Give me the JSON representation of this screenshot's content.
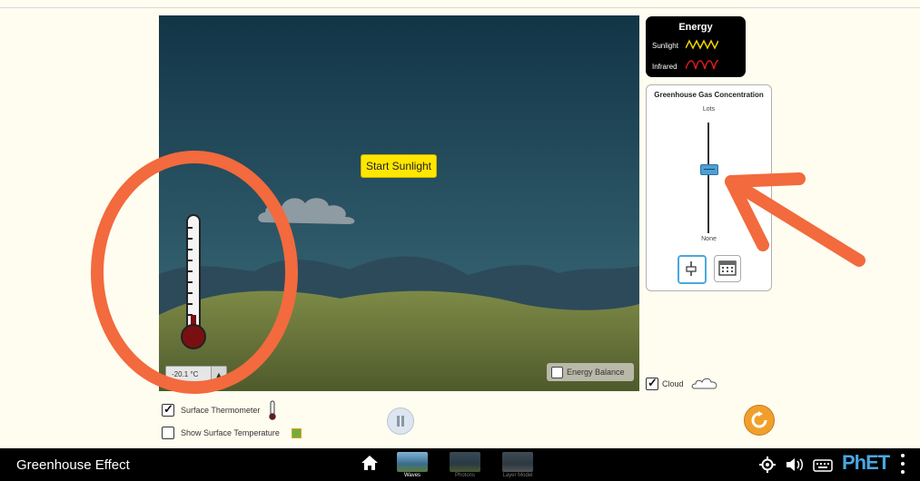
{
  "scene": {
    "start_button_label": "Start Sunlight",
    "temperature_readout": "-20.1 °C",
    "energy_balance_label": "Energy Balance"
  },
  "energy_legend": {
    "title": "Energy",
    "sunlight_label": "Sunlight",
    "infrared_label": "Infrared",
    "sunlight_color": "#f2d600",
    "infrared_color": "#e21b1b"
  },
  "ghg_panel": {
    "title": "Greenhouse Gas Concentration",
    "max_label": "Lots",
    "min_label": "None",
    "slider_level": 0.5,
    "modes": [
      "slider-mode-icon",
      "calendar-mode-icon"
    ]
  },
  "controls": {
    "cloud_label": "Cloud",
    "cloud_checked": true,
    "surface_thermometer_label": "Surface Thermometer",
    "surface_thermometer_checked": true,
    "show_surface_temperature_label": "Show Surface Temperature",
    "show_surface_temperature_checked": false
  },
  "navbar": {
    "sim_title": "Greenhouse Effect",
    "screens": [
      "Waves",
      "Photons",
      "Layer Model"
    ],
    "active_screen": "Waves",
    "brand": "PhET"
  },
  "colors": {
    "sky_top": "#123546",
    "sky_bottom": "#3a6d79",
    "ground": "#6f7a3d",
    "annotation": "#f26a3d"
  }
}
